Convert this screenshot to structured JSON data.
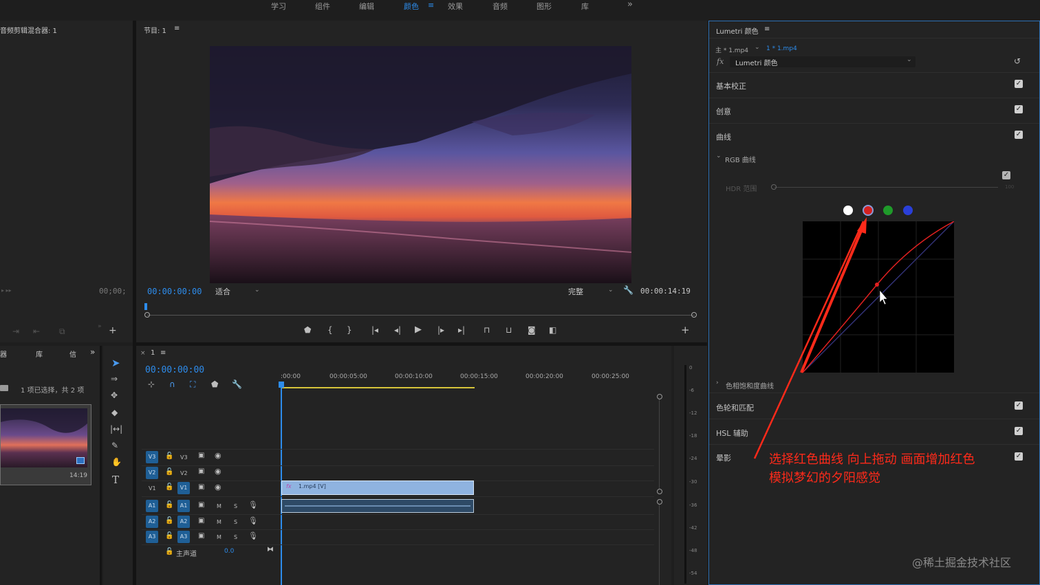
{
  "workspace_tabs": [
    "学习",
    "组件",
    "编辑",
    "颜色",
    "效果",
    "音频",
    "图形",
    "库"
  ],
  "workspace_active_menu": "≡",
  "workspace_more": "»",
  "source_panel": {
    "title": "音频剪辑混合器: 1",
    "timecode": "00;00;"
  },
  "project_panel": {
    "tabs": [
      "器",
      "库",
      "信"
    ],
    "more": "»",
    "selection_text": "1 项已选择，共 2 项",
    "thumb_duration": "14:19"
  },
  "program_monitor": {
    "title": "节目: 1",
    "menu": "≡",
    "timecode_in": "00:00:00:00",
    "fit_label": "适合",
    "quality_label": "完整",
    "duration": "00:00:14:19"
  },
  "timeline": {
    "sequence_tab": "1",
    "close": "×",
    "menu": "≡",
    "timecode": "00:00:00:00",
    "ruler": [
      ":00:00",
      "00:00:05:00",
      "00:00:10:00",
      "00:00:15:00",
      "00:00:20:00",
      "00:00:25:00"
    ],
    "video_tracks": [
      {
        "src": "V3",
        "name": "V3"
      },
      {
        "src": "V2",
        "name": "V2"
      },
      {
        "src": "V1",
        "name": "V1"
      }
    ],
    "audio_tracks": [
      {
        "src": "A1",
        "name": "A1",
        "m": "M",
        "s": "S"
      },
      {
        "src": "A2",
        "name": "A2",
        "m": "M",
        "s": "S"
      },
      {
        "src": "A3",
        "name": "A3",
        "m": "M",
        "s": "S"
      }
    ],
    "master_label": "主声道",
    "master_value": "0.0",
    "clip_label": "1.mp4 [V]",
    "clip_fx": "fx",
    "meter_ticks": [
      "0",
      "-6",
      "-12",
      "-18",
      "-24",
      "-30",
      "-36",
      "-42",
      "-48",
      "-54"
    ]
  },
  "lumetri": {
    "title": "Lumetri 颜色",
    "menu": "≡",
    "master_clip": "主 * 1.mp4",
    "seq_clip": "1 * 1.mp4",
    "fx_label": "fx",
    "effect_name": "Lumetri 颜色",
    "sections": {
      "basic": "基本校正",
      "creative": "创意",
      "curves": "曲线",
      "rgb_curves": "RGB 曲线",
      "hdr_range": "HDR 范围",
      "hdr_value": "100",
      "hue_sat": "色相饱和度曲线",
      "wheels": "色轮和匹配",
      "hsl": "HSL 辅助",
      "vignette": "晕影"
    },
    "channel_colors": [
      "#ffffff",
      "#d42020",
      "#1f9a2a",
      "#2a3fd8"
    ],
    "selected_channel": "red"
  },
  "annotation": {
    "line1": "选择红色曲线 向上拖动 画面增加红色",
    "line2": "模拟梦幻的夕阳感觉",
    "color": "#ff2a1a"
  },
  "watermark": "@稀土掘金技术社区"
}
